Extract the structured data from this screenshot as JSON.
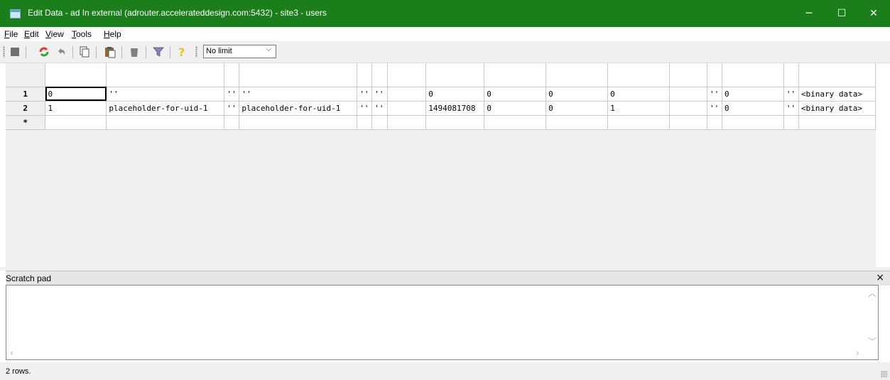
{
  "window": {
    "title": "Edit Data - ad In external (adrouter.accelerateddesign.com:5432) - site3 - users",
    "controls": {
      "minimize": "─",
      "maximize": "☐",
      "close": "✕"
    }
  },
  "menu": {
    "items": [
      {
        "first": "F",
        "rest": "ile"
      },
      {
        "first": "E",
        "rest": "dit"
      },
      {
        "first": "V",
        "rest": "iew"
      },
      {
        "first": "T",
        "rest": "ools"
      },
      {
        "first": "H",
        "rest": "elp"
      }
    ]
  },
  "toolbar": {
    "limit_value": "No limit",
    "icons": [
      "save-icon",
      "refresh-icon",
      "undo-icon",
      "copy-icon",
      "paste-icon",
      "delete-icon",
      "filter-icon",
      "help-icon"
    ]
  },
  "grid": {
    "rows": [
      {
        "num": "1",
        "cells": [
          "0",
          "''",
          "''",
          "''",
          "''",
          "''",
          "",
          "0",
          "0",
          "0",
          "0",
          "",
          "''",
          "0",
          "''",
          "<binary data>"
        ]
      },
      {
        "num": "2",
        "cells": [
          "1",
          "placeholder-for-uid-1",
          "''",
          "placeholder-for-uid-1",
          "''",
          "''",
          "",
          "1494081708",
          "0",
          "0",
          "1",
          "",
          "''",
          "0",
          "''",
          "<binary data>"
        ]
      },
      {
        "num": "*",
        "cells": [
          "",
          "",
          "",
          "",
          "",
          "",
          "",
          "",
          "",
          "",
          "",
          "",
          "",
          "",
          "",
          ""
        ]
      }
    ]
  },
  "scratch_pad": {
    "label": "Scratch pad",
    "close": "×"
  },
  "status": {
    "text": "2 rows."
  },
  "colors": {
    "titlebar": "#1a7f1a"
  }
}
